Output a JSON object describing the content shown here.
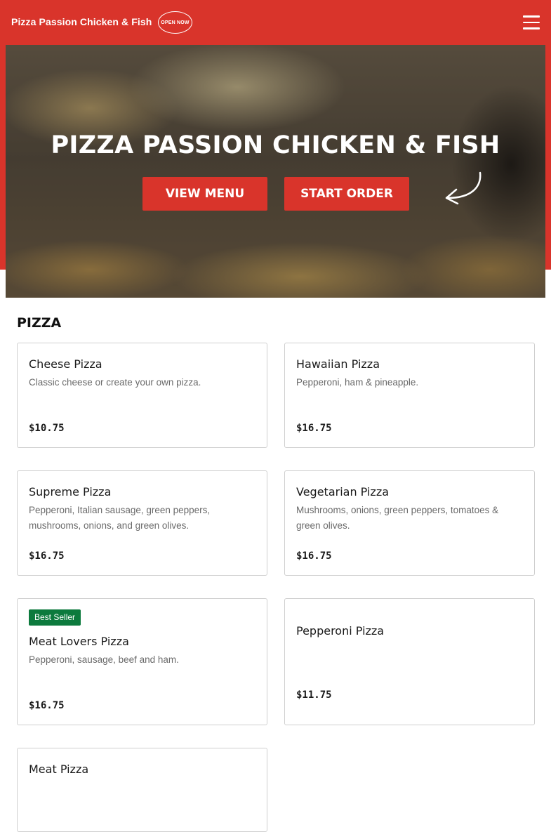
{
  "header": {
    "brand": "Pizza Passion Chicken & Fish",
    "open_badge": "OPEN NOW"
  },
  "hero": {
    "title": "PIZZA PASSION CHICKEN & FISH",
    "view_menu": "VIEW MENU",
    "start_order": "START ORDER"
  },
  "section": {
    "title": "PIZZA"
  },
  "items": [
    {
      "name": "Cheese Pizza",
      "desc": "Classic cheese or create your own pizza.",
      "price": "$10.75"
    },
    {
      "name": "Hawaiian Pizza",
      "desc": "Pepperoni, ham & pineapple.",
      "price": "$16.75"
    },
    {
      "name": "Supreme Pizza",
      "desc": "Pepperoni, Italian sausage, green peppers, mushrooms, onions, and green olives.",
      "price": "$16.75"
    },
    {
      "name": "Vegetarian Pizza",
      "desc": "Mushrooms, onions, green peppers, tomatoes & green olives.",
      "price": "$16.75"
    },
    {
      "name": "Meat Lovers Pizza",
      "desc": "Pepperoni, sausage, beef and ham.",
      "price": "$16.75",
      "badge": "Best Seller"
    },
    {
      "name": "Pepperoni Pizza",
      "desc": "",
      "price": "$11.75"
    },
    {
      "name": "Meat Pizza",
      "desc": "",
      "price": ""
    }
  ],
  "colors": {
    "brand_red": "#d9342b",
    "best_seller_green": "#0c7a3d"
  },
  "icons": {
    "menu": "hamburger-menu-icon",
    "arrow": "curved-arrow-icon"
  }
}
